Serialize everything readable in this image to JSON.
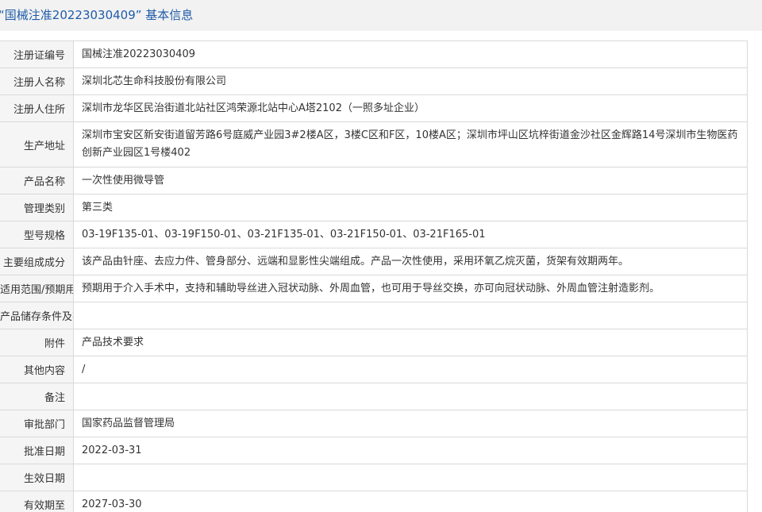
{
  "header": {
    "title": "“国械注准20223030409”  基本信息"
  },
  "rows": [
    {
      "label": "注册证编号",
      "value": "国械注准20223030409"
    },
    {
      "label": "注册人名称",
      "value": "深圳北芯生命科技股份有限公司"
    },
    {
      "label": "注册人住所",
      "value": "深圳市龙华区民治街道北站社区鸿荣源北站中心A塔2102（一照多址企业）"
    },
    {
      "label": "生产地址",
      "value": "深圳市宝安区新安街道留芳路6号庭威产业园3#2楼A区，3楼C区和F区，10楼A区；深圳市坪山区坑梓街道金沙社区金辉路14号深圳市生物医药创新产业园区1号楼402"
    },
    {
      "label": "产品名称",
      "value": "一次性使用微导管"
    },
    {
      "label": "管理类别",
      "value": "第三类"
    },
    {
      "label": "型号规格",
      "value": "03-19F135-01、03-19F150-01、03-21F135-01、03-21F150-01、03-21F165-01"
    },
    {
      "label": "主要组成成分",
      "value": "该产品由针座、去应力件、管身部分、远端和显影性尖端组成。产品一次性使用，采用环氧乙烷灭菌，货架有效期两年。"
    },
    {
      "label": "适用范围/预期用途",
      "value": "预期用于介入手术中，支持和辅助导丝进入冠状动脉、外周血管，也可用于导丝交换，亦可向冠状动脉、外周血管注射造影剂。"
    },
    {
      "label": "产品储存条件及有效期",
      "value": ""
    },
    {
      "label": "附件",
      "value": "产品技术要求"
    },
    {
      "label": "其他内容",
      "value": "/"
    },
    {
      "label": "备注",
      "value": ""
    },
    {
      "label": "审批部门",
      "value": "国家药品监督管理局"
    },
    {
      "label": "批准日期",
      "value": "2022-03-31"
    },
    {
      "label": "生效日期",
      "value": ""
    },
    {
      "label": "有效期至",
      "value": "2027-03-30"
    }
  ]
}
